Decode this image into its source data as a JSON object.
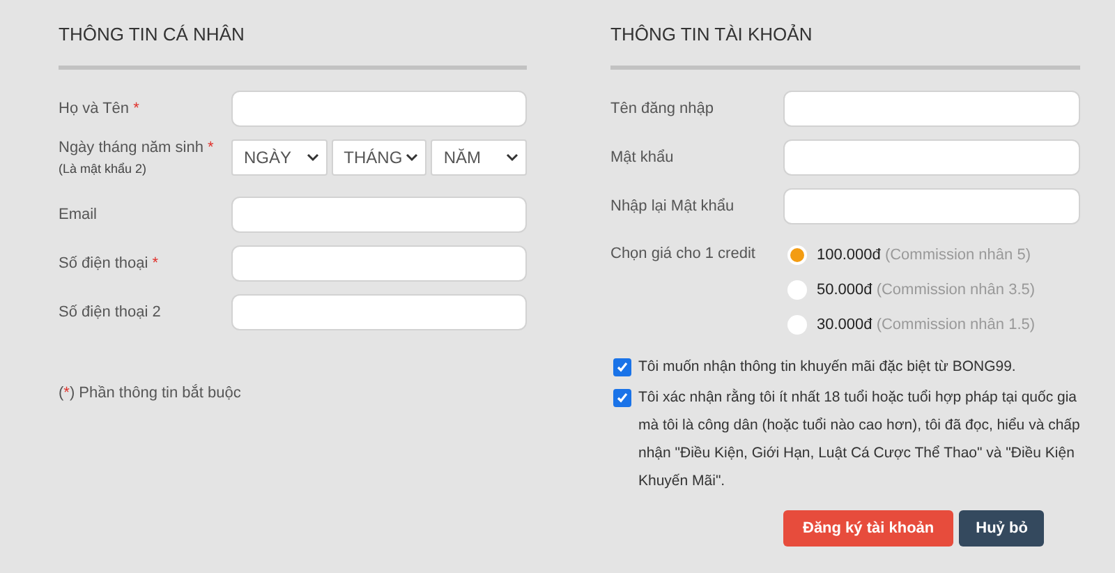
{
  "personal": {
    "heading": "THÔNG TIN CÁ NHÂN",
    "fields": [
      {
        "kind": "text",
        "label": "Họ và Tên",
        "required": true
      },
      {
        "kind": "date",
        "label": "Ngày tháng năm sinh",
        "required": true,
        "hint": "(Là mật khẩu 2)",
        "selects": [
          "NGÀY",
          "THÁNG",
          "NĂM"
        ]
      },
      {
        "kind": "text",
        "label": "Email",
        "required": false
      },
      {
        "kind": "text",
        "label": "Số điện thoại",
        "required": true
      },
      {
        "kind": "text",
        "label": "Số điện thoại 2",
        "required": false
      }
    ],
    "note": {
      "open": "(",
      "mark": "*",
      "close": ") Phần thông tin bắt buộc"
    }
  },
  "account": {
    "heading": "THÔNG TIN TÀI KHOẢN",
    "fields": [
      {
        "label": "Tên đăng nhập"
      },
      {
        "label": "Mật khẩu"
      },
      {
        "label": "Nhập lại Mật khẩu"
      }
    ],
    "credit": {
      "label": "Chọn giá cho 1 credit",
      "options": [
        {
          "price": "100.000đ",
          "note": "(Commission nhân 5)",
          "selected": true
        },
        {
          "price": "50.000đ",
          "note": "(Commission nhân 3.5)",
          "selected": false
        },
        {
          "price": "30.000đ",
          "note": "(Commission nhân 1.5)",
          "selected": false
        }
      ]
    },
    "agreements": [
      {
        "text": "Tôi muốn nhận thông tin khuyến mãi đặc biệt từ BONG99.",
        "checked": true
      },
      {
        "text": "Tôi xác nhận rằng tôi ít nhất 18 tuổi hoặc tuổi hợp pháp tại quốc gia mà tôi là công dân (hoặc tuổi nào cao hơn), tôi đã đọc, hiểu và chấp nhận \"Điều Kiện, Giới Hạn, Luật Cá Cược Thể Thao\" và \"Điều Kiện Khuyến Mãi\".",
        "checked": true
      }
    ],
    "buttons": [
      {
        "kind": "primary",
        "label": "Đăng ký tài khoản"
      },
      {
        "kind": "secondary",
        "label": "Huỷ bỏ"
      }
    ]
  }
}
